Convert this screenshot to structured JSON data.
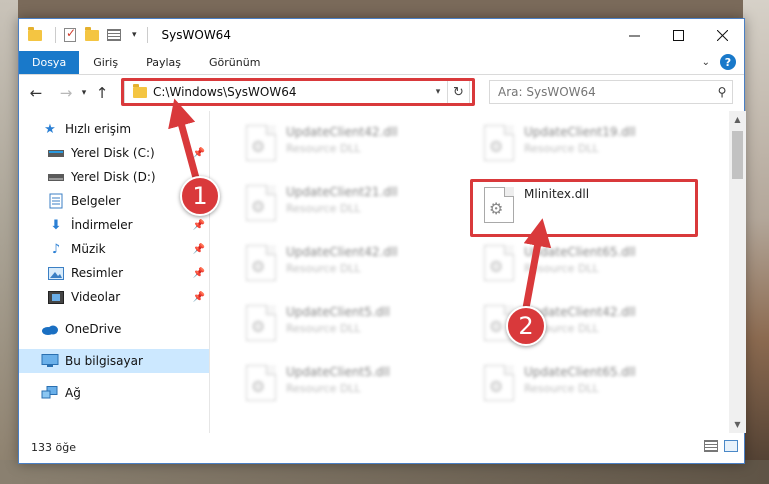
{
  "window": {
    "title": "SysWOW64"
  },
  "ribbon": {
    "tabs": [
      {
        "label": "Dosya"
      },
      {
        "label": "Giriş"
      },
      {
        "label": "Paylaş"
      },
      {
        "label": "Görünüm"
      }
    ]
  },
  "navigation": {
    "address": "C:\\Windows\\SysWOW64",
    "search_placeholder": "Ara: SysWOW64"
  },
  "sidebar": {
    "items": [
      {
        "label": "Hızlı erişim",
        "icon": "star-icon"
      },
      {
        "label": "Yerel Disk (C:)",
        "icon": "drive-icon",
        "pinned": true
      },
      {
        "label": "Yerel Disk (D:)",
        "icon": "drive-icon"
      },
      {
        "label": "Belgeler",
        "icon": "documents-icon",
        "pinned": true
      },
      {
        "label": "İndirmeler",
        "icon": "downloads-icon",
        "pinned": true
      },
      {
        "label": "Müzik",
        "icon": "music-icon",
        "pinned": true
      },
      {
        "label": "Resimler",
        "icon": "pictures-icon",
        "pinned": true
      },
      {
        "label": "Videolar",
        "icon": "videos-icon",
        "pinned": true
      },
      {
        "label": "OneDrive",
        "icon": "cloud-icon"
      },
      {
        "label": "Bu bilgisayar",
        "icon": "computer-icon",
        "selected": true
      },
      {
        "label": "Ağ",
        "icon": "network-icon"
      }
    ]
  },
  "files": [
    {
      "name": "UpdateClient42.dll",
      "type": "Resource DLL",
      "blurred": true
    },
    {
      "name": "UpdateClient19.dll",
      "type": "Resource DLL",
      "blurred": true
    },
    {
      "name": "UpdateClient21.dll",
      "type": "Resource DLL",
      "blurred": true
    },
    {
      "name": "Mlinitex.dll",
      "type": "",
      "blurred": false
    },
    {
      "name": "UpdateClient42.dll",
      "type": "Resource DLL",
      "blurred": true
    },
    {
      "name": "UpdateClient65.dll",
      "type": "Resource DLL",
      "blurred": true
    },
    {
      "name": "UpdateClient5.dll",
      "type": "Resource DLL",
      "blurred": true
    },
    {
      "name": "UpdateClient42.dll",
      "type": "Resource DLL",
      "blurred": true
    },
    {
      "name": "UpdateClient5.dll",
      "type": "Resource DLL",
      "blurred": true
    },
    {
      "name": "UpdateClient65.dll",
      "type": "Resource DLL",
      "blurred": true
    }
  ],
  "status": {
    "item_count": "133 öğe"
  },
  "annotations": {
    "marker1": "1",
    "marker2": "2",
    "accent_color": "#d9393b"
  }
}
